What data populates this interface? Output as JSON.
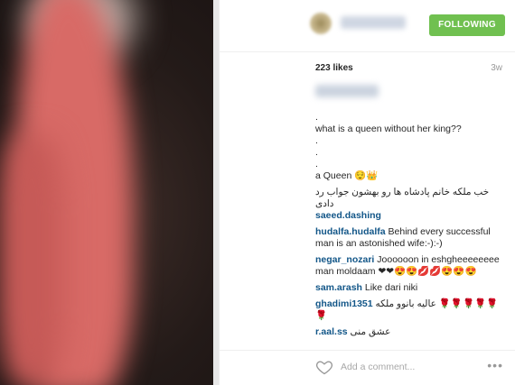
{
  "post": {
    "follow_label": "FOLLOWING",
    "likes": "223 likes",
    "time_ago": "3w",
    "caption_lines": [
      ".",
      "what is a queen without her king??",
      ".",
      ".",
      ".",
      "a Queen 😌👑"
    ],
    "comments": [
      {
        "user": "",
        "text": "خب ملکه خانم پادشاه ها رو بهشون جواب رد دادی"
      },
      {
        "user": "saeed.dashing",
        "text": ""
      },
      {
        "user": "hudalfa.hudalfa",
        "text": "Behind every successful man is an astonished wife:-):-)"
      },
      {
        "user": "negar_nozari",
        "text": "Joooooon in eshgheeeeeeee man moldaam ❤❤😍😍💋💋😍😍😍"
      },
      {
        "user": "sam.arash",
        "text": "Like dari niki"
      },
      {
        "user": "ghadimi1351",
        "text": "عالیه بانوو ملکه 🌹🌹🌹🌹🌹🌹"
      },
      {
        "user": "r.aal.ss",
        "text": "عشق منی"
      }
    ],
    "add_comment_placeholder": "Add a comment...",
    "more_label": "•••"
  },
  "colors": {
    "follow_button": "#70c050",
    "username_link": "#125688"
  },
  "icons": {
    "like": "heart-outline-icon",
    "more": "ellipsis-icon"
  }
}
